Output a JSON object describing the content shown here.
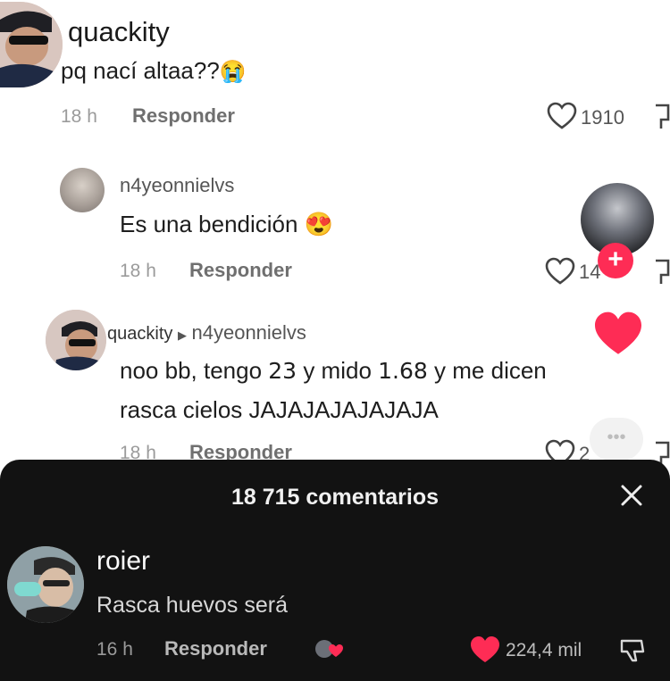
{
  "comments": [
    {
      "username": "quackity",
      "text": "pq nací altaa??",
      "emoji": "😭",
      "time": "18 h",
      "reply_label": "Responder",
      "likes": "1910"
    },
    {
      "username": "n4yeonnielvs",
      "text": "Es una bendición",
      "emoji": "😍",
      "time": "18 h",
      "reply_label": "Responder",
      "likes": "14"
    },
    {
      "username": "quackity",
      "reply_to": "n4yeonnielvs",
      "text_line1_a": "noo bb, tengo",
      "text_line1_b": "23",
      "text_line1_c": "y mido",
      "text_line1_d": "1.68",
      "text_line1_e": "y me dicen",
      "text_line2": "rasca cielos JAJAJAJAJAJAJA",
      "time": "18 h",
      "reply_label": "Responder",
      "likes": "2"
    }
  ],
  "sheet": {
    "title": "18 715 comentarios",
    "close_icon": "close-icon",
    "comment": {
      "username": "roier",
      "text": "Rasca huevos será",
      "time": "16 h",
      "reply_label": "Responder",
      "likes": "224,4 mil"
    }
  },
  "colors": {
    "accent": "#fe2c55",
    "sheet_bg": "#121212"
  }
}
